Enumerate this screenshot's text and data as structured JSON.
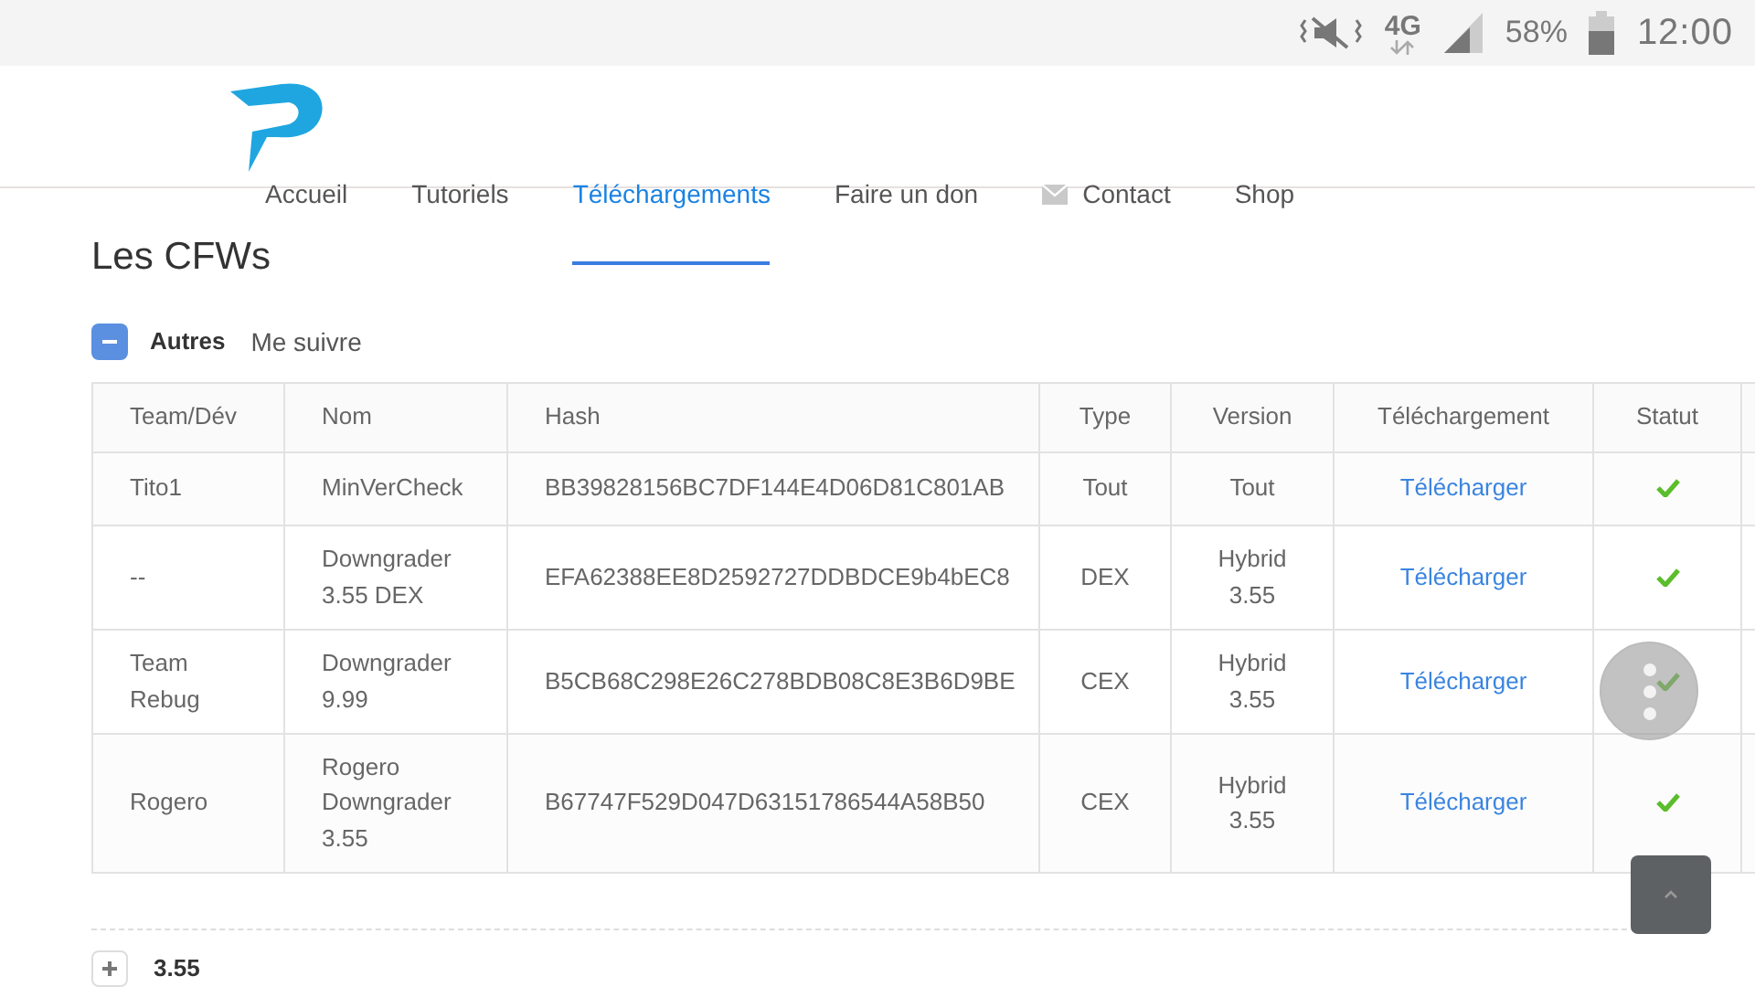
{
  "status_bar": {
    "network": "4G",
    "battery": "58%",
    "time": "12:00"
  },
  "nav": {
    "items": [
      {
        "label": "Accueil",
        "selected": false,
        "kind": "plain"
      },
      {
        "label": "Tutoriels",
        "selected": false,
        "kind": "plain"
      },
      {
        "label": "Téléchargements",
        "selected": true,
        "kind": "plain"
      },
      {
        "label": "Faire un don",
        "selected": false,
        "kind": "plain"
      },
      {
        "label": "Contact",
        "selected": false,
        "kind": "mail"
      },
      {
        "label": "Shop",
        "selected": false,
        "kind": "plain"
      }
    ]
  },
  "page_title": "Les CFWs",
  "section": {
    "label": "Autres",
    "expanded": true,
    "tabs": [
      "Me suivre"
    ]
  },
  "table": {
    "columns": [
      "Team/Dév",
      "Nom",
      "Hash",
      "Type",
      "Version",
      "Téléchargement",
      "Statut"
    ],
    "rows": [
      {
        "team": "Tito1",
        "name": "MinVerCheck",
        "hash": "BB39828156BC7DF144E4D06D81C801AB",
        "type": "Tout",
        "version": "Tout",
        "download": "Télécharger",
        "ok": true
      },
      {
        "team": "--",
        "name": "Downgrader 3.55 DEX",
        "hash": "EFA62388EE8D2592727DDBDCE9b4bEC8",
        "type": "DEX",
        "version": "Hybrid 3.55",
        "download": "Télécharger",
        "ok": true
      },
      {
        "team": "Team Rebug",
        "name": "Downgrader 9.99",
        "hash": "B5CB68C298E26C278BDB08C8E3B6D9BE",
        "type": "CEX",
        "version": "Hybrid 3.55",
        "download": "Télécharger",
        "ok": true
      },
      {
        "team": "Rogero",
        "name": "Rogero Downgrader 3.55",
        "hash": "B67747F529D047D63151786544A58B50",
        "type": "CEX",
        "version": "Hybrid 3.55",
        "download": "Télécharger",
        "ok": true
      }
    ]
  },
  "next_section": {
    "label": "3.55",
    "expanded": false
  }
}
